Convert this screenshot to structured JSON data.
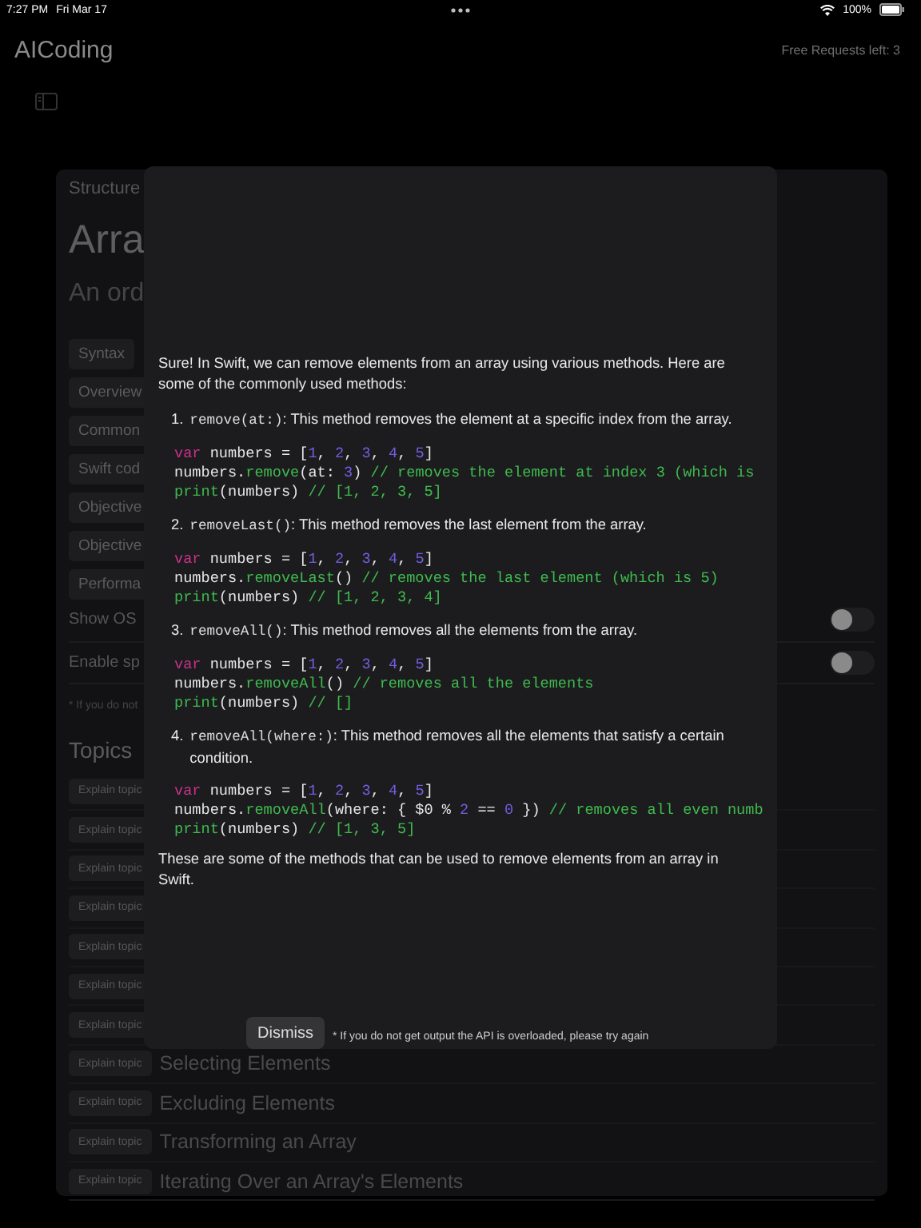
{
  "status_bar": {
    "time": "7:27 PM",
    "date": "Fri Mar 17",
    "battery": "100%"
  },
  "header": {
    "title": "AICoding",
    "requests": "Free Requests left: 3"
  },
  "page": {
    "breadcrumb": "Structure",
    "title": "Arra",
    "subtitle": "An ord",
    "sections": [
      "Syntax",
      "Overview",
      "Common",
      "Swift cod",
      "Objective",
      "Objective",
      "Performa"
    ],
    "settings": [
      {
        "label": "Show OS",
        "on": false
      },
      {
        "label": "Enable sp",
        "on": false
      }
    ],
    "footnote": "* If you do not",
    "topics_heading": "Topics",
    "topics": [
      {
        "button": "Explain topic"
      },
      {
        "button": "Explain topic"
      },
      {
        "button": "Explain topic"
      },
      {
        "button": "Explain topic"
      },
      {
        "button": "Explain topic"
      },
      {
        "button": "Explain topic"
      },
      {
        "button": "Explain topic"
      },
      {
        "button": "Explain topic",
        "title": "Selecting Elements"
      },
      {
        "button": "Explain topic",
        "title": "Excluding Elements"
      },
      {
        "button": "Explain topic",
        "title": "Transforming an Array"
      },
      {
        "button": "Explain topic",
        "title": "Iterating Over an Array's Elements"
      }
    ]
  },
  "dialog": {
    "blocks": [
      {
        "kind": "paragraph",
        "text": "Sure! In Swift, we can remove elements from an array using various methods. Here are some of the commonly used methods:"
      },
      {
        "kind": "item",
        "number": "1.",
        "method": "remove(at:)",
        "text": ": This method removes the element at a specific index from the array."
      },
      {
        "kind": "code",
        "lines": [
          [
            {
              "kind": "keyword",
              "text": "var"
            },
            {
              "kind": "plain",
              "text": " numbers = ["
            },
            {
              "kind": "number",
              "text": "1"
            },
            {
              "kind": "plain",
              "text": ", "
            },
            {
              "kind": "number",
              "text": "2"
            },
            {
              "kind": "plain",
              "text": ", "
            },
            {
              "kind": "number",
              "text": "3"
            },
            {
              "kind": "plain",
              "text": ", "
            },
            {
              "kind": "number",
              "text": "4"
            },
            {
              "kind": "plain",
              "text": ", "
            },
            {
              "kind": "number",
              "text": "5"
            },
            {
              "kind": "plain",
              "text": "]"
            }
          ],
          [
            {
              "kind": "plain",
              "text": "numbers."
            },
            {
              "kind": "function",
              "text": "remove"
            },
            {
              "kind": "plain",
              "text": "(at: "
            },
            {
              "kind": "number",
              "text": "3"
            },
            {
              "kind": "plain",
              "text": ") "
            },
            {
              "kind": "comment",
              "text": "// removes the element at index 3 (which is"
            }
          ],
          [
            {
              "kind": "function",
              "text": "print"
            },
            {
              "kind": "plain",
              "text": "(numbers) "
            },
            {
              "kind": "comment",
              "text": "// [1, 2, 3, 5]"
            }
          ]
        ]
      },
      {
        "kind": "item",
        "number": "2.",
        "method": "removeLast()",
        "text": ": This method removes the last element from the array."
      },
      {
        "kind": "code",
        "lines": [
          [
            {
              "kind": "keyword",
              "text": "var"
            },
            {
              "kind": "plain",
              "text": " numbers = ["
            },
            {
              "kind": "number",
              "text": "1"
            },
            {
              "kind": "plain",
              "text": ", "
            },
            {
              "kind": "number",
              "text": "2"
            },
            {
              "kind": "plain",
              "text": ", "
            },
            {
              "kind": "number",
              "text": "3"
            },
            {
              "kind": "plain",
              "text": ", "
            },
            {
              "kind": "number",
              "text": "4"
            },
            {
              "kind": "plain",
              "text": ", "
            },
            {
              "kind": "number",
              "text": "5"
            },
            {
              "kind": "plain",
              "text": "]"
            }
          ],
          [
            {
              "kind": "plain",
              "text": "numbers."
            },
            {
              "kind": "function",
              "text": "removeLast"
            },
            {
              "kind": "plain",
              "text": "() "
            },
            {
              "kind": "comment",
              "text": "// removes the last element (which is 5)"
            }
          ],
          [
            {
              "kind": "function",
              "text": "print"
            },
            {
              "kind": "plain",
              "text": "(numbers) "
            },
            {
              "kind": "comment",
              "text": "// [1, 2, 3, 4]"
            }
          ]
        ]
      },
      {
        "kind": "item",
        "number": "3.",
        "method": "removeAll()",
        "text": ": This method removes all the elements from the array."
      },
      {
        "kind": "code",
        "lines": [
          [
            {
              "kind": "keyword",
              "text": "var"
            },
            {
              "kind": "plain",
              "text": " numbers = ["
            },
            {
              "kind": "number",
              "text": "1"
            },
            {
              "kind": "plain",
              "text": ", "
            },
            {
              "kind": "number",
              "text": "2"
            },
            {
              "kind": "plain",
              "text": ", "
            },
            {
              "kind": "number",
              "text": "3"
            },
            {
              "kind": "plain",
              "text": ", "
            },
            {
              "kind": "number",
              "text": "4"
            },
            {
              "kind": "plain",
              "text": ", "
            },
            {
              "kind": "number",
              "text": "5"
            },
            {
              "kind": "plain",
              "text": "]"
            }
          ],
          [
            {
              "kind": "plain",
              "text": "numbers."
            },
            {
              "kind": "function",
              "text": "removeAll"
            },
            {
              "kind": "plain",
              "text": "() "
            },
            {
              "kind": "comment",
              "text": "// removes all the elements"
            }
          ],
          [
            {
              "kind": "function",
              "text": "print"
            },
            {
              "kind": "plain",
              "text": "(numbers) "
            },
            {
              "kind": "comment",
              "text": "// []"
            }
          ]
        ]
      },
      {
        "kind": "item",
        "number": "4.",
        "method": "removeAll(where:)",
        "text": ": This method removes all the elements that satisfy a certain condition."
      },
      {
        "kind": "code",
        "lines": [
          [
            {
              "kind": "keyword",
              "text": "var"
            },
            {
              "kind": "plain",
              "text": " numbers = ["
            },
            {
              "kind": "number",
              "text": "1"
            },
            {
              "kind": "plain",
              "text": ", "
            },
            {
              "kind": "number",
              "text": "2"
            },
            {
              "kind": "plain",
              "text": ", "
            },
            {
              "kind": "number",
              "text": "3"
            },
            {
              "kind": "plain",
              "text": ", "
            },
            {
              "kind": "number",
              "text": "4"
            },
            {
              "kind": "plain",
              "text": ", "
            },
            {
              "kind": "number",
              "text": "5"
            },
            {
              "kind": "plain",
              "text": "]"
            }
          ],
          [
            {
              "kind": "plain",
              "text": "numbers."
            },
            {
              "kind": "function",
              "text": "removeAll"
            },
            {
              "kind": "plain",
              "text": "(where: { $0 % "
            },
            {
              "kind": "number",
              "text": "2"
            },
            {
              "kind": "plain",
              "text": " == "
            },
            {
              "kind": "number",
              "text": "0"
            },
            {
              "kind": "plain",
              "text": " }) "
            },
            {
              "kind": "comment",
              "text": "// removes all even numb"
            }
          ],
          [
            {
              "kind": "function",
              "text": "print"
            },
            {
              "kind": "plain",
              "text": "(numbers) "
            },
            {
              "kind": "comment",
              "text": "// [1, 3, 5]"
            }
          ]
        ]
      },
      {
        "kind": "paragraph",
        "text": "These are some of the methods that can be used to remove elements from an array in Swift."
      }
    ],
    "dismiss": "Dismiss",
    "note": "* If you do not get output the API is overloaded, please try again"
  }
}
